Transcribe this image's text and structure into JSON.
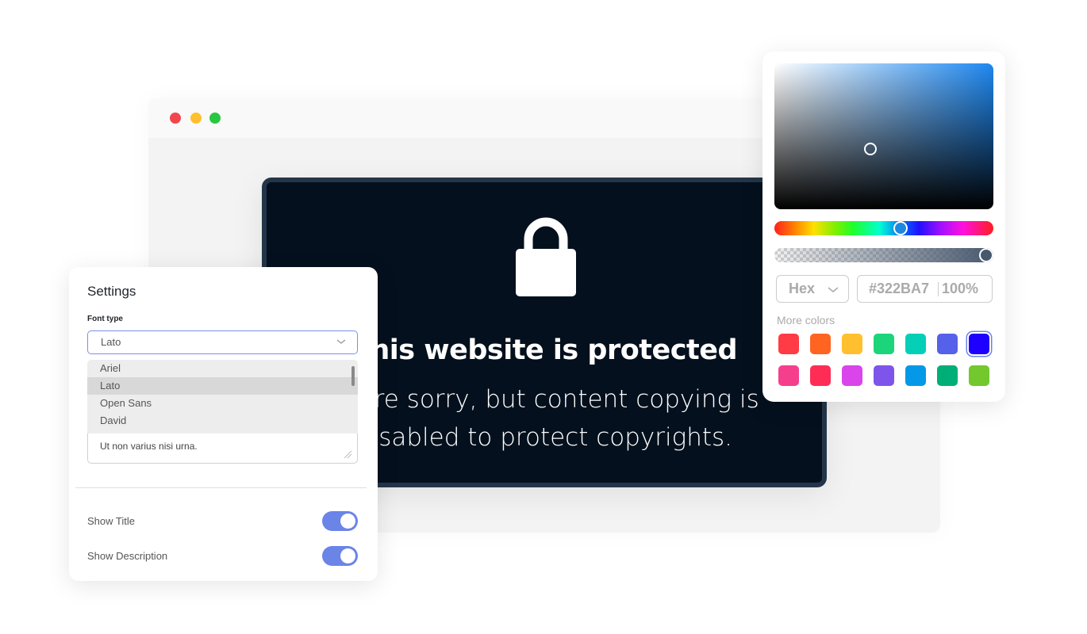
{
  "browser": {
    "window_controls": [
      "close",
      "minimize",
      "maximize"
    ],
    "colors": {
      "close": "#f2464f",
      "minimize": "#ffbf2e",
      "maximize": "#27c840"
    }
  },
  "protected_notice": {
    "icon": "lock-icon",
    "title": "This website is protected",
    "description_line1": "We're sorry, but content copying is",
    "description_line2": "disabled to protect copyrights."
  },
  "settings": {
    "title": "Settings",
    "font_type_label": "Font type",
    "font_type_value": "Lato",
    "font_options": [
      "Ariel",
      "Lato",
      "Open Sans",
      "David"
    ],
    "selected_option": "Lato",
    "text_area_value": "Ut non varius nisi urna.",
    "toggles": [
      {
        "label": "Show Title",
        "on": true
      },
      {
        "label": "Show Description",
        "on": true
      }
    ],
    "accent_color": "#6b84e8"
  },
  "color_picker": {
    "format": "Hex",
    "hex_value": "#322BA7",
    "opacity": "100%",
    "more_colors_label": "More colors",
    "swatches": [
      "#ff3b45",
      "#ff6420",
      "#ffbf2e",
      "#1cd47a",
      "#05cfb7",
      "#5561e8",
      "#1e00ff",
      "#f53f8d",
      "#ff2d55",
      "#d945ea",
      "#7d55ea",
      "#0498e8",
      "#00ae78",
      "#72c82c"
    ],
    "selected_swatch_index": 6
  }
}
